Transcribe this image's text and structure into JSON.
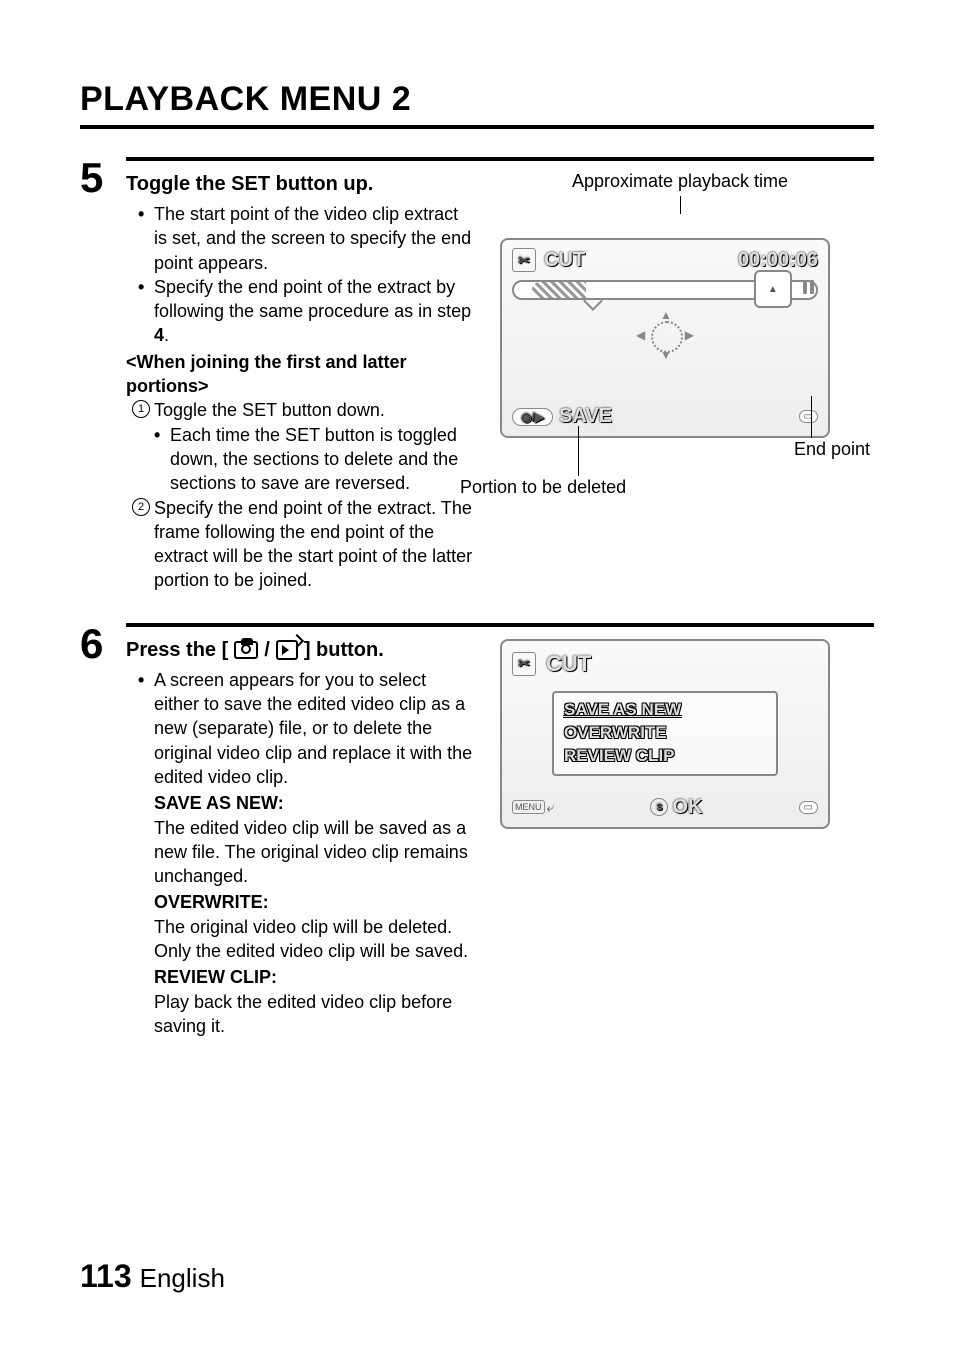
{
  "title": "PLAYBACK MENU 2",
  "step5": {
    "heading": "Toggle the SET button up.",
    "b1": "The start point of the video clip extract is set, and the screen to specify the end point appears.",
    "b2_pre": "Specify the end point of the extract by following the same procedure as in step ",
    "b2_stepnum": "4",
    "b2_post": ".",
    "subhead": "<When joining the first and latter portions>",
    "n1": "Toggle the SET button down.",
    "n1b": "Each time the SET button is toggled down, the sections to delete and the sections to save are reversed.",
    "n2": "Specify the end point of the extract. The frame following the end point of the extract will be the start point of the latter portion to be joined.",
    "fig_top": "Approximate playback time",
    "fig_cut": "CUT",
    "fig_time": "00:00:06",
    "fig_save": "SAVE",
    "fig_end": "End point",
    "fig_portion": "Portion to be deleted"
  },
  "step6": {
    "heading_pre": "Press the [",
    "heading_post": "] button.",
    "b1": "A screen appears for you to select either to save the edited video clip as a new (separate) file, or to delete the original video clip and replace it with the edited video clip.",
    "san_h": "SAVE AS NEW:",
    "san_t": "The edited video clip will be saved as a new file. The original video clip remains unchanged.",
    "ow_h": "OVERWRITE:",
    "ow_t": "The original video clip will be deleted. Only the edited video clip will be saved.",
    "rc_h": "REVIEW CLIP:",
    "rc_t": "Play back the edited video clip before saving it.",
    "fig_cut": "CUT",
    "opt1": "SAVE AS NEW",
    "opt2": "OVERWRITE",
    "opt3": "REVIEW CLIP",
    "menu": "MENU",
    "ok": "OK"
  },
  "pagenum": "113",
  "lang": "English"
}
